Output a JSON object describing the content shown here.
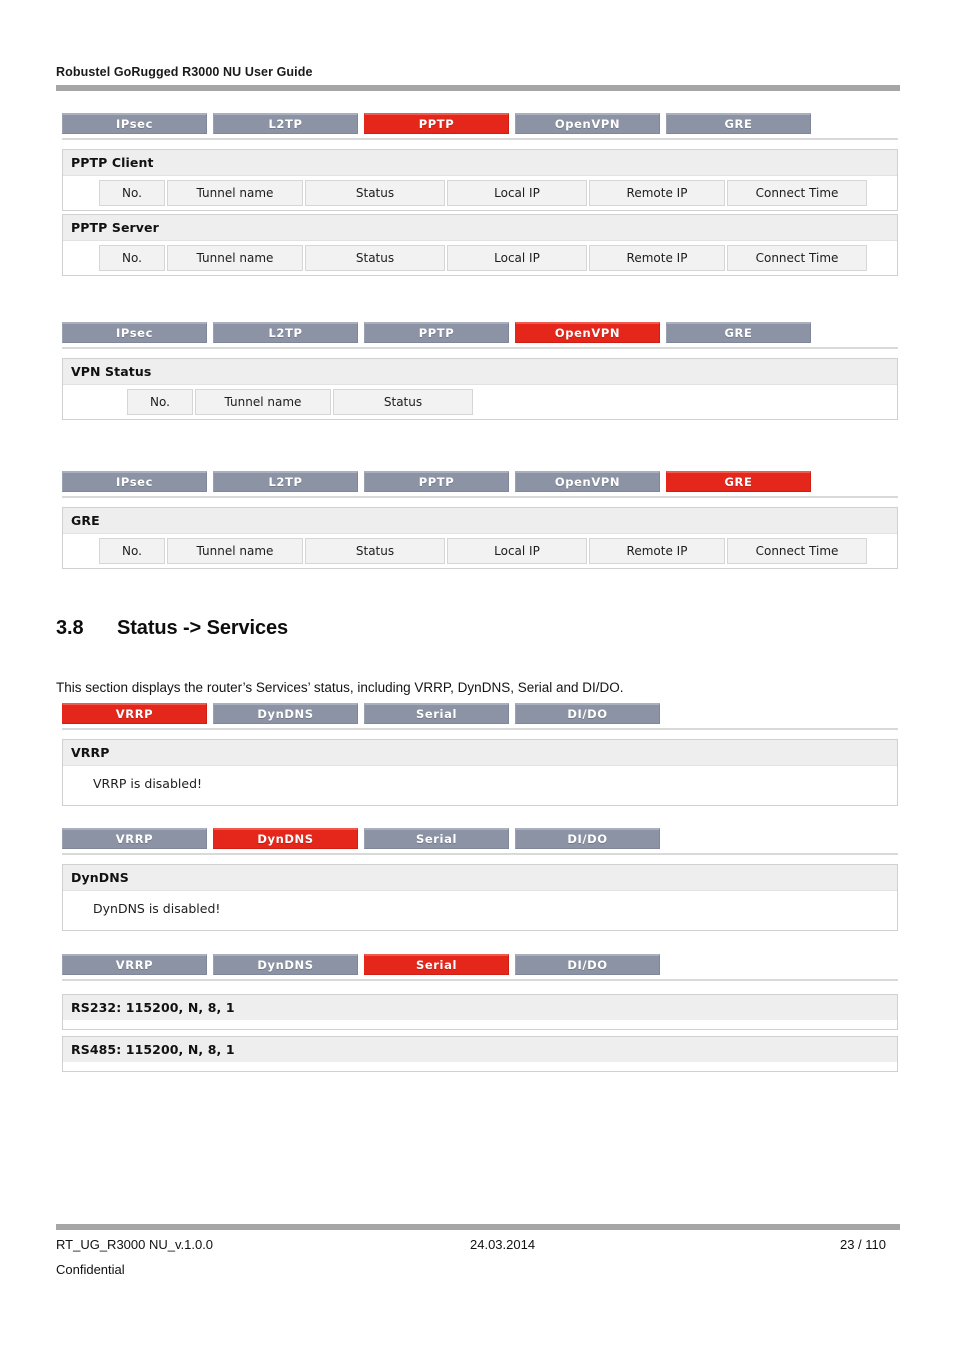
{
  "document": {
    "running_header": "Robustel GoRugged R3000 NU User Guide",
    "footer": {
      "doc_id": "RT_UG_R3000 NU_v.1.0.0",
      "date": "24.03.2014",
      "page": "23 / 110",
      "classification": "Confidential"
    }
  },
  "colors": {
    "tab_active": "#E4261B",
    "tab_inactive": "#8B93A4",
    "panel_header": "#EEEEEE",
    "rule": "#A6A6A6"
  },
  "section": {
    "number": "3.8",
    "title": "Status -> Services",
    "intro": "This section displays the router’s Services’ status, including VRRP, DynDNS, Serial and DI/DO."
  },
  "vpn_tabs": [
    "IPsec",
    "L2TP",
    "PPTP",
    "OpenVPN",
    "GRE"
  ],
  "service_tabs": [
    "VRRP",
    "DynDNS",
    "Serial",
    "DI/DO"
  ],
  "vpn_table_headers": [
    "No.",
    "Tunnel name",
    "Status",
    "Local IP",
    "Remote IP",
    "Connect Time"
  ],
  "openvpn_table_headers": [
    "No.",
    "Tunnel name",
    "Status"
  ],
  "screens": [
    {
      "id": "pptp",
      "active_tab": "PPTP",
      "panels": [
        {
          "title": "PPTP Client",
          "type": "table"
        },
        {
          "title": "PPTP Server",
          "type": "table"
        }
      ]
    },
    {
      "id": "openvpn",
      "active_tab": "OpenVPN",
      "panels": [
        {
          "title": "VPN Status",
          "type": "table-narrow"
        }
      ]
    },
    {
      "id": "gre",
      "active_tab": "GRE",
      "panels": [
        {
          "title": "GRE",
          "type": "table"
        }
      ]
    },
    {
      "id": "vrrp",
      "active_tab": "VRRP",
      "panels": [
        {
          "title": "VRRP",
          "type": "message",
          "message": "VRRP is disabled!"
        }
      ]
    },
    {
      "id": "dyndns",
      "active_tab": "DynDNS",
      "panels": [
        {
          "title": "DynDNS",
          "type": "message",
          "message": "DynDNS is disabled!"
        }
      ]
    },
    {
      "id": "serial",
      "active_tab": "Serial",
      "panels": [
        {
          "title": "RS232: 115200, N, 8, 1",
          "type": "serial"
        },
        {
          "title": "RS485: 115200, N, 8, 1",
          "type": "serial"
        }
      ]
    }
  ]
}
